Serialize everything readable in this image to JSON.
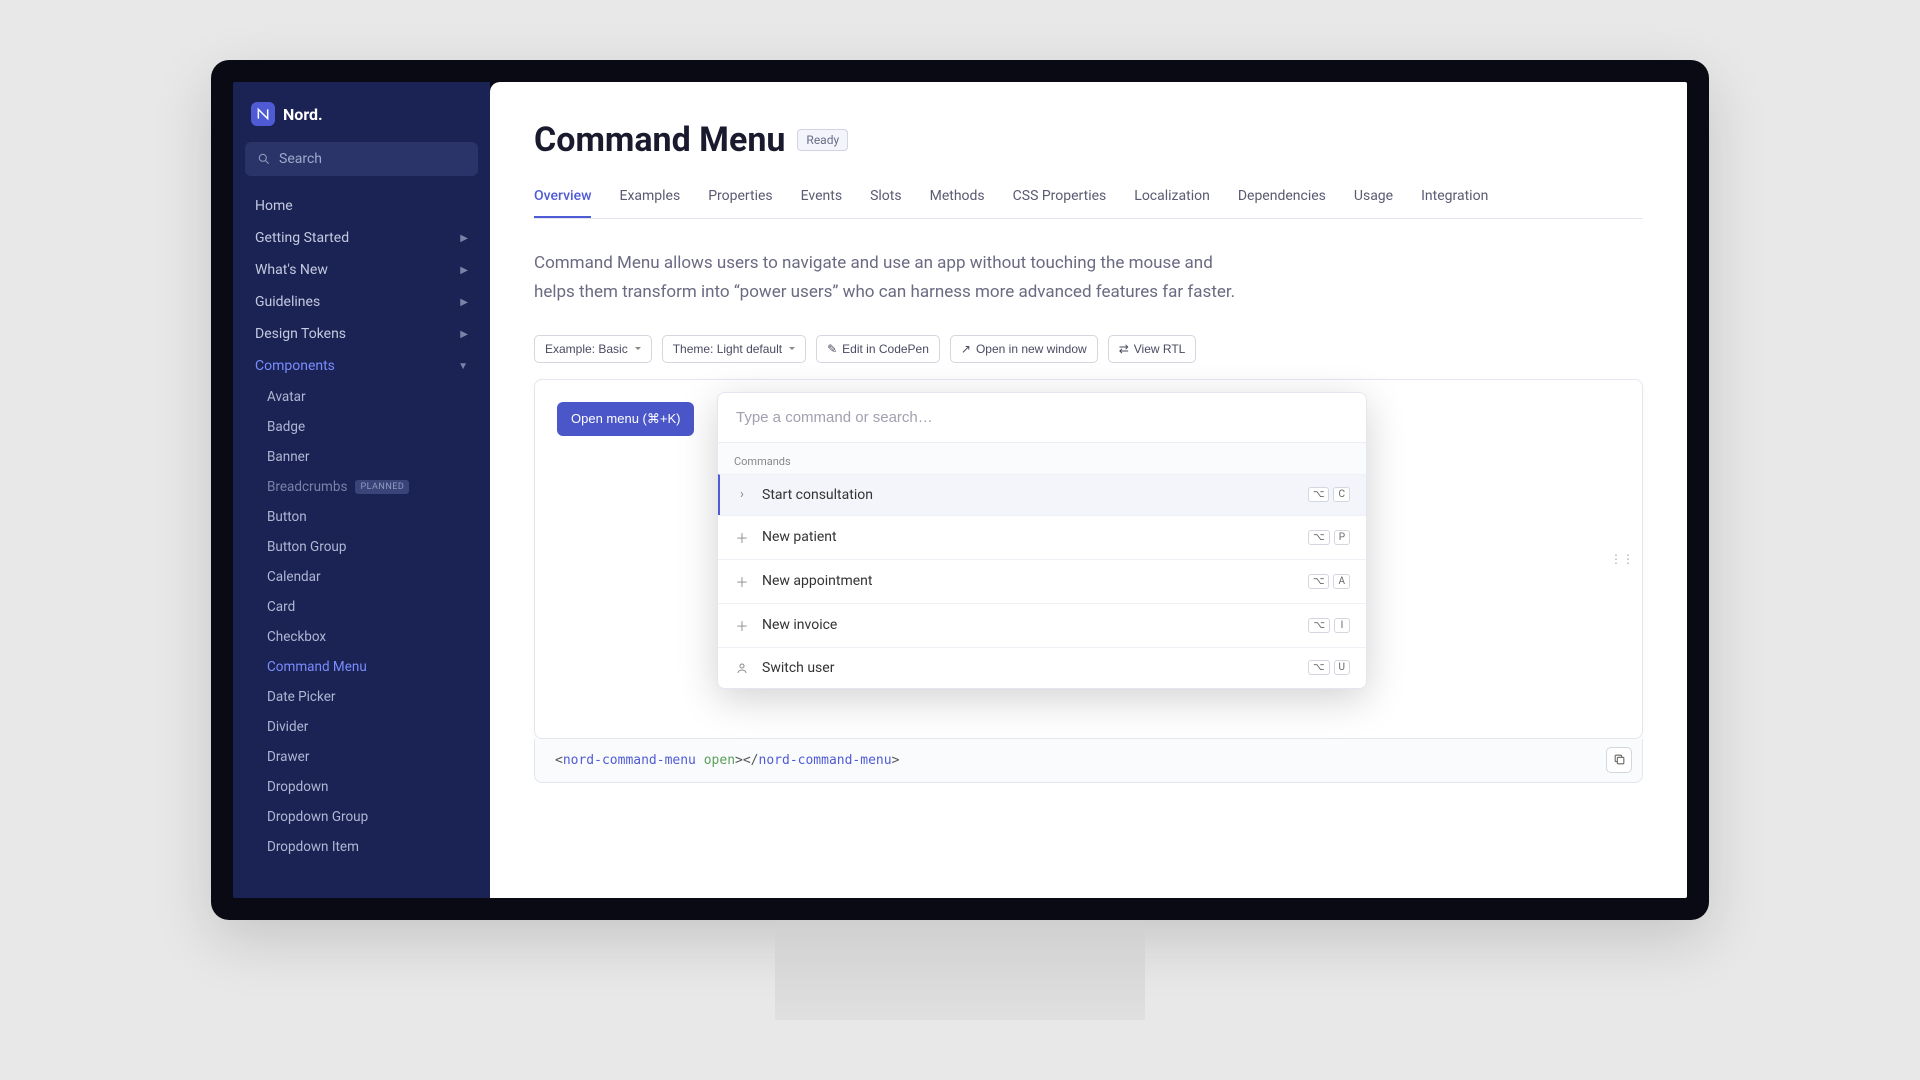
{
  "brand": "Nord.",
  "search_placeholder": "Search",
  "nav": {
    "items": [
      {
        "label": "Home",
        "has_sub": false
      },
      {
        "label": "Getting Started",
        "has_sub": true
      },
      {
        "label": "What's New",
        "has_sub": true
      },
      {
        "label": "Guidelines",
        "has_sub": true
      },
      {
        "label": "Design Tokens",
        "has_sub": true
      },
      {
        "label": "Components",
        "has_sub": true,
        "active": true
      }
    ],
    "subs": [
      {
        "label": "Avatar"
      },
      {
        "label": "Badge"
      },
      {
        "label": "Banner"
      },
      {
        "label": "Breadcrumbs",
        "badge": "PLANNED",
        "muted": true
      },
      {
        "label": "Button"
      },
      {
        "label": "Button Group"
      },
      {
        "label": "Calendar"
      },
      {
        "label": "Card"
      },
      {
        "label": "Checkbox"
      },
      {
        "label": "Command Menu",
        "active": true
      },
      {
        "label": "Date Picker"
      },
      {
        "label": "Divider"
      },
      {
        "label": "Drawer"
      },
      {
        "label": "Dropdown"
      },
      {
        "label": "Dropdown Group"
      },
      {
        "label": "Dropdown Item"
      }
    ]
  },
  "page": {
    "title": "Command Menu",
    "status": "Ready",
    "tabs": [
      "Overview",
      "Examples",
      "Properties",
      "Events",
      "Slots",
      "Methods",
      "CSS Properties",
      "Localization",
      "Dependencies",
      "Usage",
      "Integration"
    ],
    "active_tab": 0,
    "description": "Command Menu allows users to navigate and use an app without touching the mouse and helps them transform into “power users” who can harness more advanced features far faster."
  },
  "toolbar": {
    "example": "Example: Basic",
    "theme": "Theme: Light default",
    "codepen": "Edit in CodePen",
    "newwin": "Open in new window",
    "rtl": "View RTL"
  },
  "demo": {
    "open_button": "Open menu (⌘+K)",
    "input_placeholder": "Type a command or search…",
    "section_label": "Commands",
    "items": [
      {
        "icon": "chevron-right",
        "label": "Start consultation",
        "keys": [
          "⌥",
          "C"
        ],
        "hl": true
      },
      {
        "icon": "plus",
        "label": "New patient",
        "keys": [
          "⌥",
          "P"
        ]
      },
      {
        "icon": "plus",
        "label": "New appointment",
        "keys": [
          "⌥",
          "A"
        ]
      },
      {
        "icon": "plus",
        "label": "New invoice",
        "keys": [
          "⌥",
          "I"
        ]
      },
      {
        "icon": "user",
        "label": "Switch user",
        "keys": [
          "⌥",
          "U"
        ]
      }
    ]
  },
  "code": {
    "open_tag": "nord-command-menu",
    "attr": "open",
    "close_tag": "nord-command-menu"
  }
}
